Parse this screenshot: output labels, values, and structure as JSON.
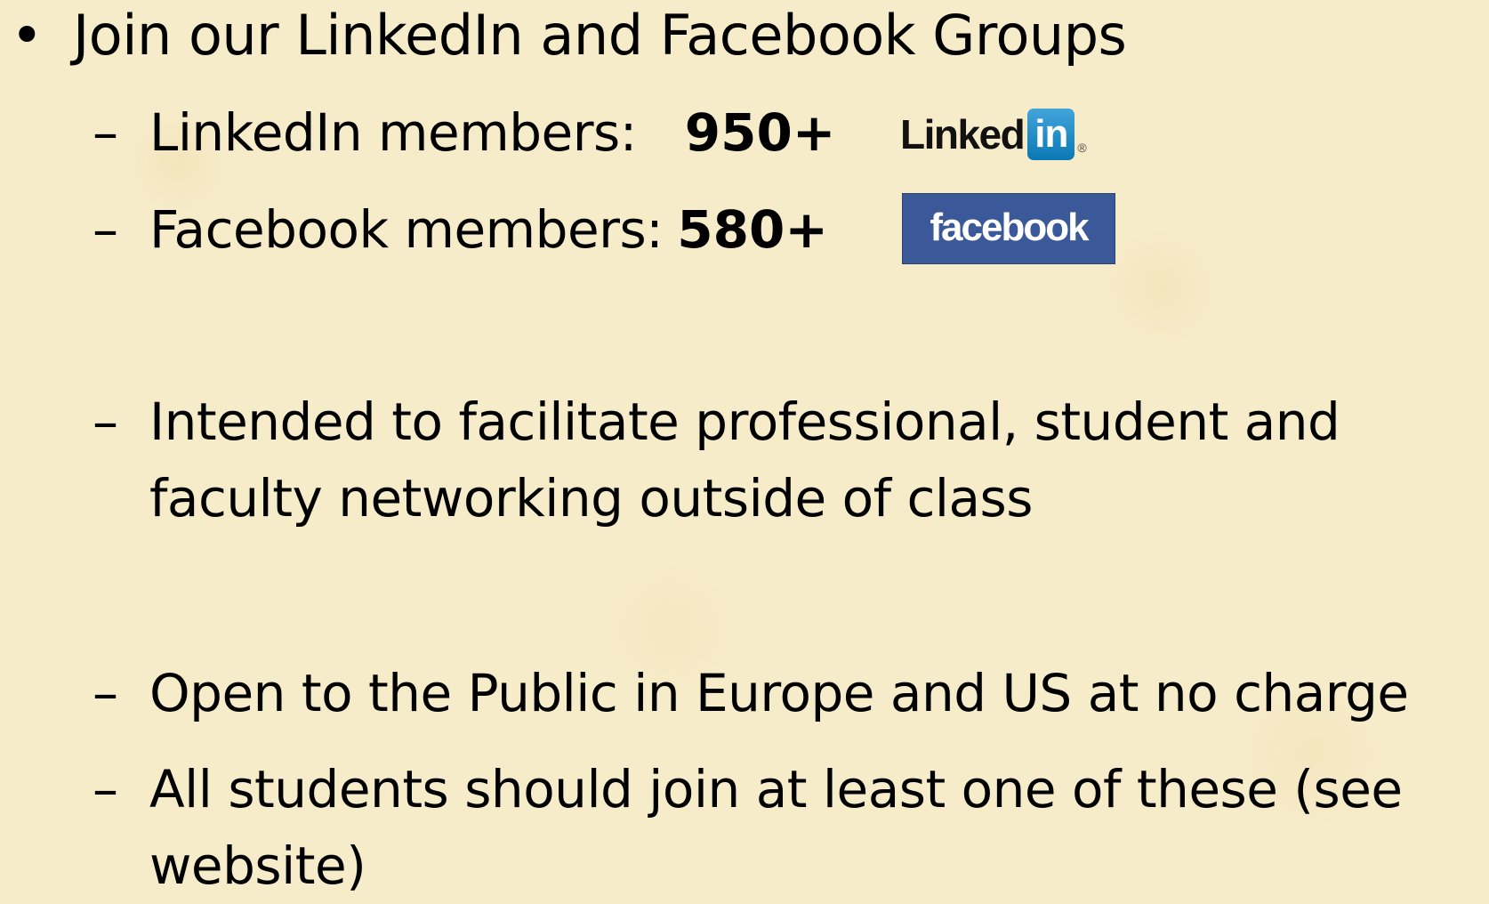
{
  "slide": {
    "main_bullet": {
      "marker": "•",
      "text": "Join our LinkedIn and Facebook Groups"
    },
    "sub_bullets": [
      {
        "marker": "–",
        "label": "LinkedIn members:",
        "value": "950+"
      },
      {
        "marker": "–",
        "label": "Facebook members:",
        "value": "580+"
      },
      {
        "marker": "–",
        "line1": "Intended to facilitate professional, student and",
        "line2": "faculty networking outside of class"
      },
      {
        "marker": "–",
        "text": "Open to the Public in Europe and US at no charge"
      },
      {
        "marker": "–",
        "line1": "All students should join at least one of these (see",
        "line2": "website)"
      }
    ],
    "logos": {
      "linkedin": {
        "word": "Linked",
        "badge": "in",
        "mark": "®"
      },
      "facebook": {
        "word": "facebook"
      }
    }
  },
  "colors": {
    "background": "#f7ecca",
    "text": "#000000",
    "linkedin_blue": "#0b78b4",
    "facebook_blue": "#3b5998"
  }
}
